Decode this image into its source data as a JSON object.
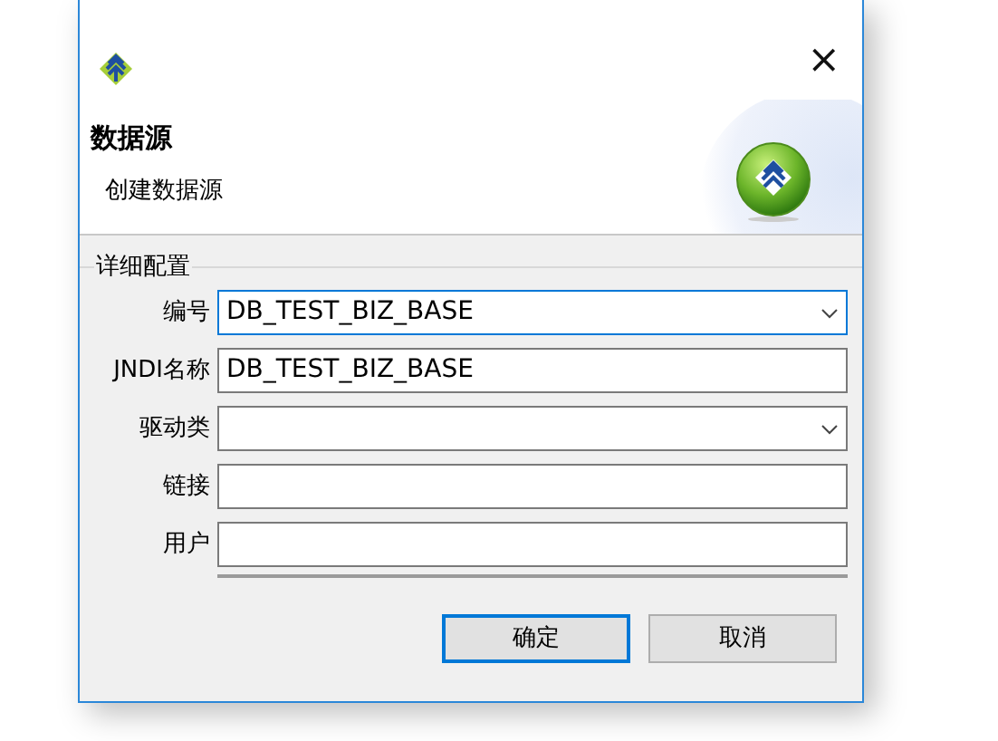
{
  "window": {
    "close_glyph": "×"
  },
  "header": {
    "title": "数据源",
    "subtitle": "创建数据源"
  },
  "group": {
    "title": "详细配置"
  },
  "fields": [
    {
      "label": "编号",
      "kind": "combo",
      "value": "DB_TEST_BIZ_BASE",
      "focused": true
    },
    {
      "label": "JNDI名称",
      "kind": "text",
      "value": "DB_TEST_BIZ_BASE",
      "focused": false
    },
    {
      "label": "驱动类",
      "kind": "combo",
      "focused": false
    },
    {
      "label": "链接",
      "kind": "text",
      "focused": false
    },
    {
      "label": "用户",
      "kind": "text",
      "focused": false
    }
  ],
  "buttons": [
    {
      "label": "确定",
      "default": true
    },
    {
      "label": "取消",
      "default": false
    }
  ]
}
